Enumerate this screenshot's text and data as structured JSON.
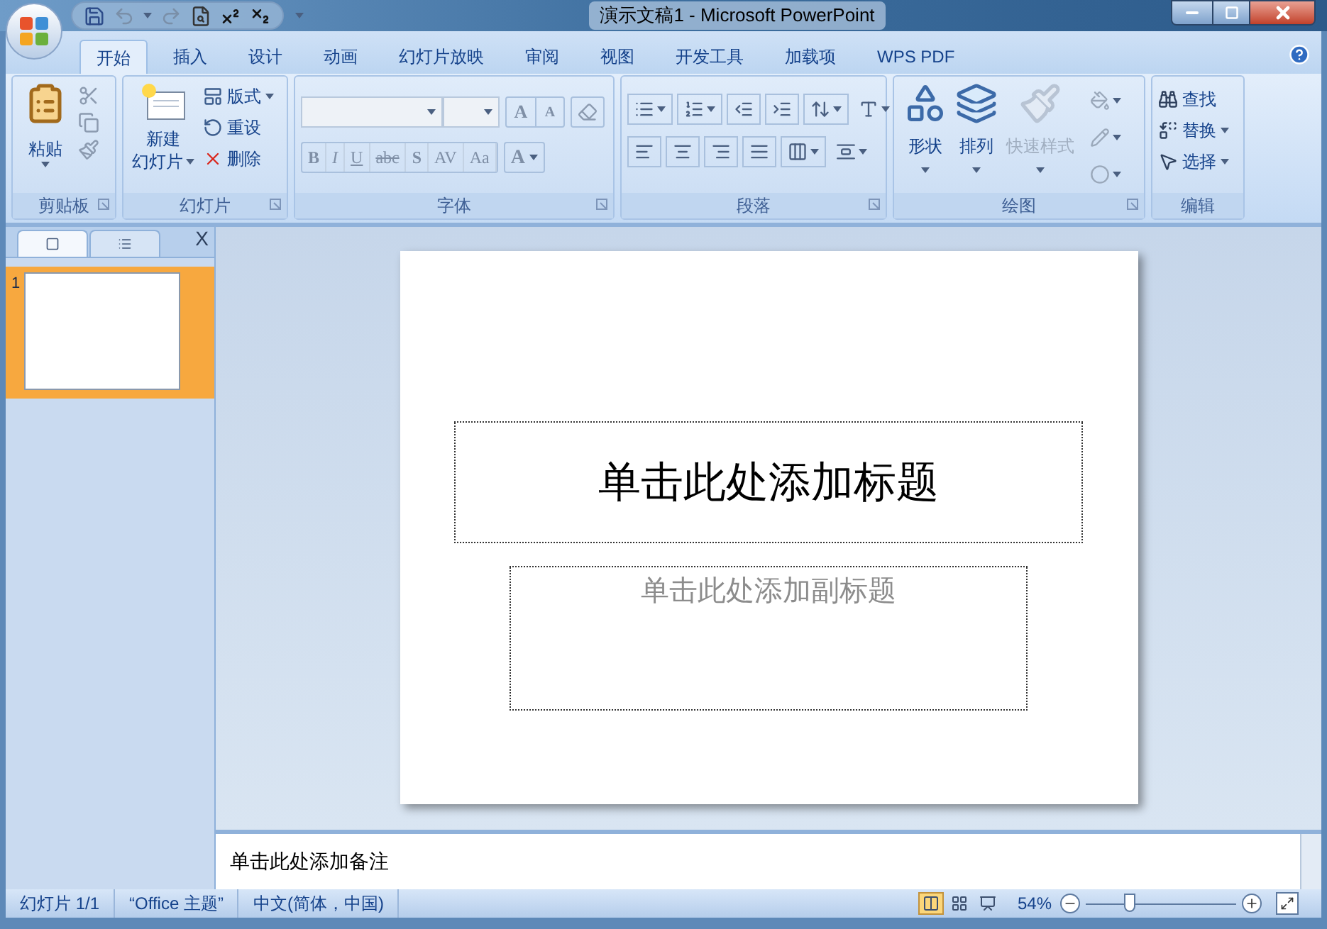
{
  "window": {
    "title": "演示文稿1 - Microsoft PowerPoint"
  },
  "tabs": [
    {
      "label": "开始",
      "selected": true
    },
    {
      "label": "插入",
      "selected": false
    },
    {
      "label": "设计",
      "selected": false
    },
    {
      "label": "动画",
      "selected": false
    },
    {
      "label": "幻灯片放映",
      "selected": false
    },
    {
      "label": "审阅",
      "selected": false
    },
    {
      "label": "视图",
      "selected": false
    },
    {
      "label": "开发工具",
      "selected": false
    },
    {
      "label": "加载项",
      "selected": false
    },
    {
      "label": "WPS PDF",
      "selected": false
    }
  ],
  "ribbon": {
    "clipboard": {
      "label": "剪贴板",
      "paste": "粘贴"
    },
    "slides": {
      "label": "幻灯片",
      "new_slide": [
        "新建",
        "幻灯片"
      ],
      "items": [
        {
          "kind": "layout",
          "label": "版式",
          "dropdown": true
        },
        {
          "kind": "reset",
          "label": "重设",
          "dropdown": false
        },
        {
          "kind": "delete",
          "label": "删除",
          "dropdown": false
        }
      ]
    },
    "font": {
      "label": "字体",
      "grow": "A",
      "shrink": "A",
      "format_buttons": [
        {
          "kind": "bold",
          "text": "B"
        },
        {
          "kind": "italic",
          "text": "I"
        },
        {
          "kind": "underline",
          "text": "U"
        },
        {
          "kind": "strike",
          "text": "abc"
        },
        {
          "kind": "shadow",
          "text": "S"
        },
        {
          "kind": "spacing",
          "text": "AV"
        },
        {
          "kind": "case",
          "text": "Aa"
        }
      ],
      "color_button": "A"
    },
    "paragraph": {
      "label": "段落"
    },
    "drawing": {
      "label": "绘图",
      "buttons": [
        {
          "kind": "shapes",
          "label": "形状",
          "disabled": false
        },
        {
          "kind": "arrange",
          "label": "排列",
          "disabled": false
        },
        {
          "kind": "quick_styles",
          "label": "快速样式",
          "disabled": true
        }
      ]
    },
    "editing": {
      "label": "编辑",
      "items": [
        {
          "kind": "find",
          "label": "查找",
          "dropdown": false
        },
        {
          "kind": "replace",
          "label": "替换",
          "dropdown": true
        },
        {
          "kind": "select",
          "label": "选择",
          "dropdown": true
        }
      ]
    }
  },
  "panel": {
    "tabs": [
      {
        "kind": "slides",
        "selected": true
      },
      {
        "kind": "outline",
        "selected": false
      }
    ],
    "close": "X",
    "thumbnails": [
      {
        "number": "1",
        "selected": true
      }
    ]
  },
  "slide": {
    "title_placeholder": "单击此处添加标题",
    "subtitle_placeholder": "单击此处添加副标题"
  },
  "notes": {
    "placeholder": "单击此处添加备注"
  },
  "status_bar": {
    "items": [
      "幻灯片 1/1",
      "“Office 主题”",
      "中文(简体，中国)"
    ],
    "views": [
      {
        "kind": "normal",
        "selected": true
      },
      {
        "kind": "sorter",
        "selected": false
      },
      {
        "kind": "show",
        "selected": false
      }
    ],
    "zoom": "54%",
    "zoom_slider": {
      "level": 0.29
    }
  }
}
